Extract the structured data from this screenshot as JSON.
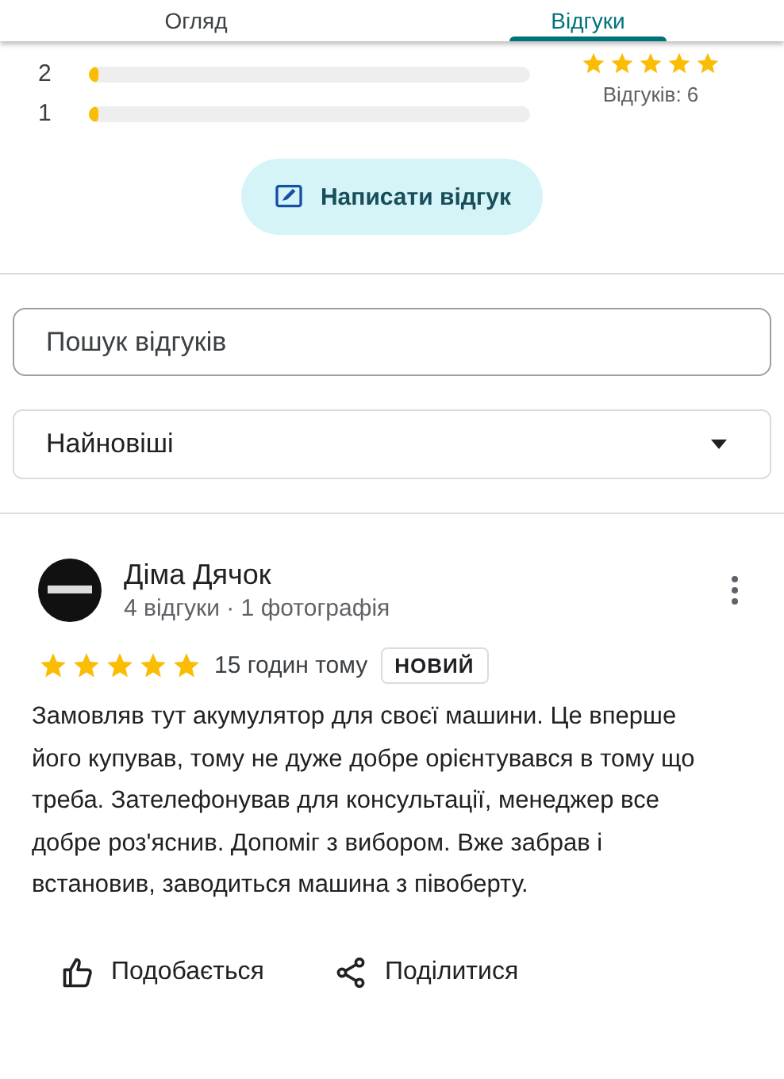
{
  "tabs": [
    {
      "label": "Огляд",
      "selected": false
    },
    {
      "label": "Відгуки",
      "selected": true
    }
  ],
  "summary": {
    "distribution": [
      {
        "label": "2",
        "level": 0.02
      },
      {
        "label": "1",
        "level": 0.02
      }
    ],
    "stars": 5,
    "count": "Відгуків: 6"
  },
  "write_button": "Написати відгук",
  "search": {
    "placeholder": "Пошук відгуків"
  },
  "sort": {
    "value": "Найновіші"
  },
  "review": {
    "author": "Діма Дячок",
    "meta": "4 відгуки · 1 фотографія",
    "stars": 5,
    "time": "15 годин тому",
    "badge": "НОВИЙ",
    "text": "Замовляв тут акумулятор для своєї машини. Це вперше його купував, тому не дуже добре орієнтувався в тому що треба. Зателефонував для консультації, менеджер все добре роз'яснив. Допоміг з вибором. Вже забрав і встановив, заводиться машина з півоберту.",
    "actions": [
      {
        "kind": "like",
        "label": "Подобається"
      },
      {
        "kind": "share",
        "label": "Поділитися"
      }
    ]
  }
}
